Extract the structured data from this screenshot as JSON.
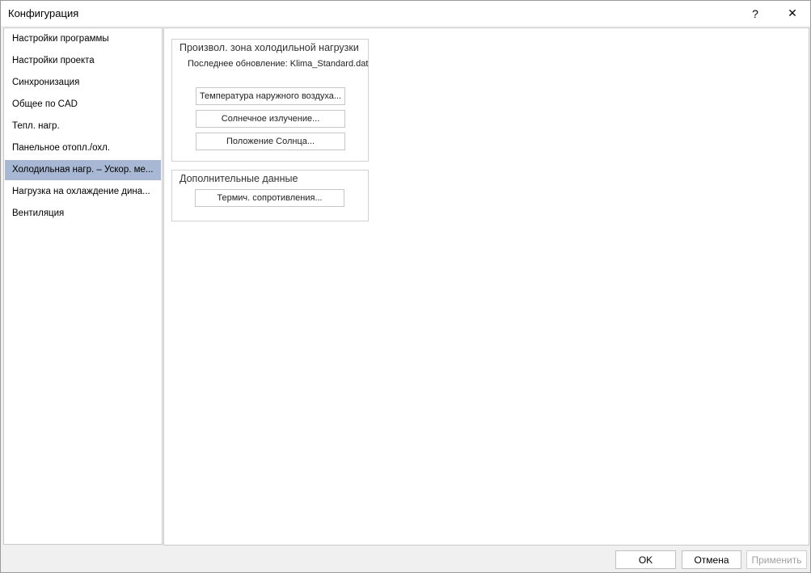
{
  "window": {
    "title": "Конфигурация",
    "help_label": "?",
    "close_label": "✕"
  },
  "sidebar": {
    "items": [
      {
        "label": "Настройки программы"
      },
      {
        "label": "Настройки проекта"
      },
      {
        "label": "Синхронизация"
      },
      {
        "label": "Общее по CAD"
      },
      {
        "label": "Тепл. нагр."
      },
      {
        "label": "Панельное отопл./охл."
      },
      {
        "label": "Холодильная нагр. – Ускор. ме..."
      },
      {
        "label": "Нагрузка на охлаждение дина..."
      },
      {
        "label": "Вентиляция"
      }
    ],
    "selected_index": 6
  },
  "main": {
    "group1": {
      "title": "Произвол. зона холодильной нагрузки",
      "info": "Последнее обновление: Klima_Standard.dat",
      "buttons": [
        {
          "label": "Температура наружного воздуха..."
        },
        {
          "label": "Солнечное излучение..."
        },
        {
          "label": "Положение Солнца..."
        }
      ]
    },
    "group2": {
      "title": "Дополнительные данные",
      "buttons": [
        {
          "label": "Термич. сопротивления..."
        }
      ]
    }
  },
  "footer": {
    "ok_label": "OK",
    "cancel_label": "Отмена",
    "apply_label": "Применить"
  },
  "colors": {
    "selected_item_bg": "#a8b8d4",
    "window_bg": "#f0f0f0"
  }
}
